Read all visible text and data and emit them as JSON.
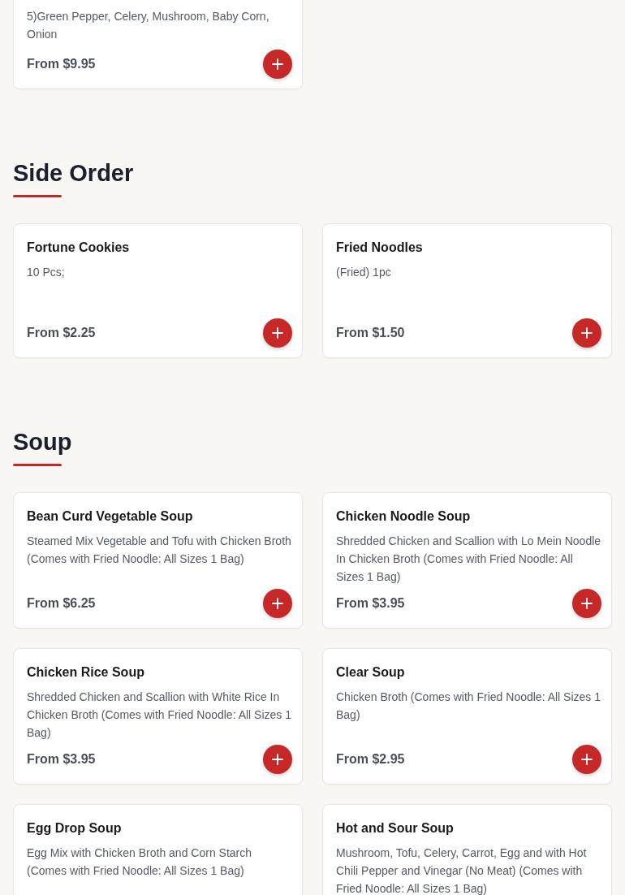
{
  "sections": [
    {
      "items": [
        {
          "description": "5)Green Pepper, Celery, Mushroom, Baby Corn, Onion",
          "price": "From $9.95",
          "cut_top": true
        }
      ]
    },
    {
      "title": "Side Order",
      "items": [
        {
          "name": "Fortune Cookies",
          "description": "10 Pcs;",
          "price": "From $2.25"
        },
        {
          "name": "Fried Noodles",
          "description": "(Fried) 1pc",
          "price": "From $1.50"
        }
      ]
    },
    {
      "title": "Soup",
      "items": [
        {
          "name": "Bean Curd Vegetable Soup",
          "description": "Steamed Mix Vegetable and Tofu with Chicken Broth (Comes with Fried Noodle: All Sizes 1 Bag)",
          "price": "From $6.25"
        },
        {
          "name": "Chicken Noodle Soup",
          "description": "Shredded Chicken and Scallion with Lo Mein Noodle In Chicken Broth (Comes with Fried Noodle: All Sizes 1 Bag)",
          "price": "From $3.95"
        },
        {
          "name": "Chicken Rice Soup",
          "description": "Shredded Chicken and Scallion with White Rice In Chicken Broth (Comes with Fried Noodle: All Sizes 1 Bag)",
          "price": "From $3.95"
        },
        {
          "name": "Clear Soup",
          "description": "Chicken Broth (Comes with Fried Noodle: All Sizes 1 Bag)",
          "price": "From $2.95"
        },
        {
          "name": "Egg Drop Soup",
          "description": "Egg Mix with Chicken Broth and Corn Starch (Comes with Fried Noodle: All Sizes 1 Bag)"
        },
        {
          "name": "Hot and Sour Soup",
          "description": "Mushroom, Tofu, Celery, Carrot, Egg and with Hot Chili Pepper and Vinegar (No Meat) (Comes with Fried Noodle: All Sizes 1 Bag)"
        }
      ]
    }
  ]
}
